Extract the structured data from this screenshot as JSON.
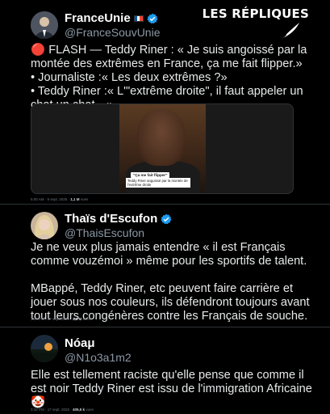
{
  "watermark": {
    "text": "LES RÉPLIQUES"
  },
  "tweets": [
    {
      "display_name": "FranceUnie",
      "handle": "@FranceSouvUnie",
      "text": "🔴 FLASH — Teddy Riner : « Je suis angoissé par la montée des extrêmes en France, ça me fait flipper.»\n• Journaliste :« Les deux extrêmes ?»\n• Teddy Riner :« L'\"extrême droite\", il faut appeler un chat un chat…»",
      "media": {
        "caption_1": "\"Ça me fait flipper\"",
        "caption_2": "Teddy Riner angoissé par la montée de l'extrême droite"
      },
      "timestamp": "5:00 AM · 9 sept. 2025 ·",
      "views": "1,1 M",
      "views_label": "vues"
    },
    {
      "display_name": "Thaïs d'Escufon",
      "handle": "@ThaisEscufon",
      "text": "Je ne veux plus jamais entendre « il est Français comme vouzémoi » même pour les sportifs de talent.\n\nMBappé, Teddy Riner, etc peuvent faire carrière et jouer sous nos couleurs, ils défendront toujours avant tout leurs congénères contre les Français de souche.",
      "timestamp": "3:19 PM · 17 sept. 2025 ·",
      "views": "3,6 M",
      "views_label": "vues"
    },
    {
      "display_name": "Nóaμ",
      "handle": "@N1o3a1m2",
      "text": "Elle est tellement raciste qu'elle pense que comme il est noir Teddy Riner est issu de l'immigration Africaine🤡",
      "timestamp": "3:32 PM · 17 sept. 2025 ·",
      "views": "405,5 k",
      "views_label": "vues"
    }
  ],
  "icons": {
    "verified": "verified-badge-icon",
    "flag": "france-flag-icon",
    "quill": "quill-pen-icon"
  },
  "colors": {
    "verified": "#1d9bf0",
    "handle": "#8b98a5",
    "background": "#000000"
  }
}
